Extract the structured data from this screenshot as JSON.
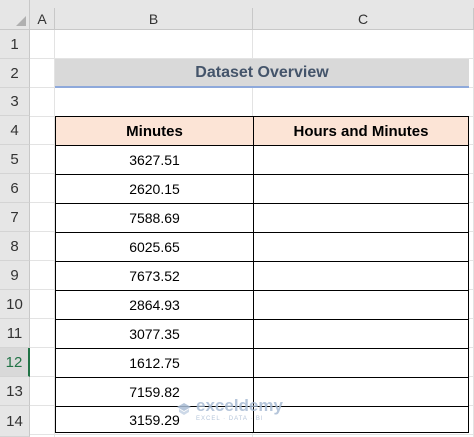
{
  "columns": [
    "A",
    "B",
    "C"
  ],
  "rows": [
    "1",
    "2",
    "3",
    "4",
    "5",
    "6",
    "7",
    "8",
    "9",
    "10",
    "11",
    "12",
    "13",
    "14"
  ],
  "active_row": "12",
  "title": "Dataset Overview",
  "table": {
    "headers": [
      "Minutes",
      "Hours and Minutes"
    ],
    "minutes": [
      "3627.51",
      "2620.15",
      "7588.69",
      "6025.65",
      "7673.52",
      "2864.93",
      "3077.35",
      "1612.75",
      "7159.82",
      "3159.29"
    ]
  },
  "watermark": {
    "name": "exceldemy",
    "tagline": "EXCEL · DATA · BI",
    "icon": "exceldemy-logo-icon"
  },
  "colors": {
    "header_fill": "#fce4d6",
    "title_fill": "#d9d9d9",
    "title_text": "#44546a",
    "active_row": "#217346"
  }
}
